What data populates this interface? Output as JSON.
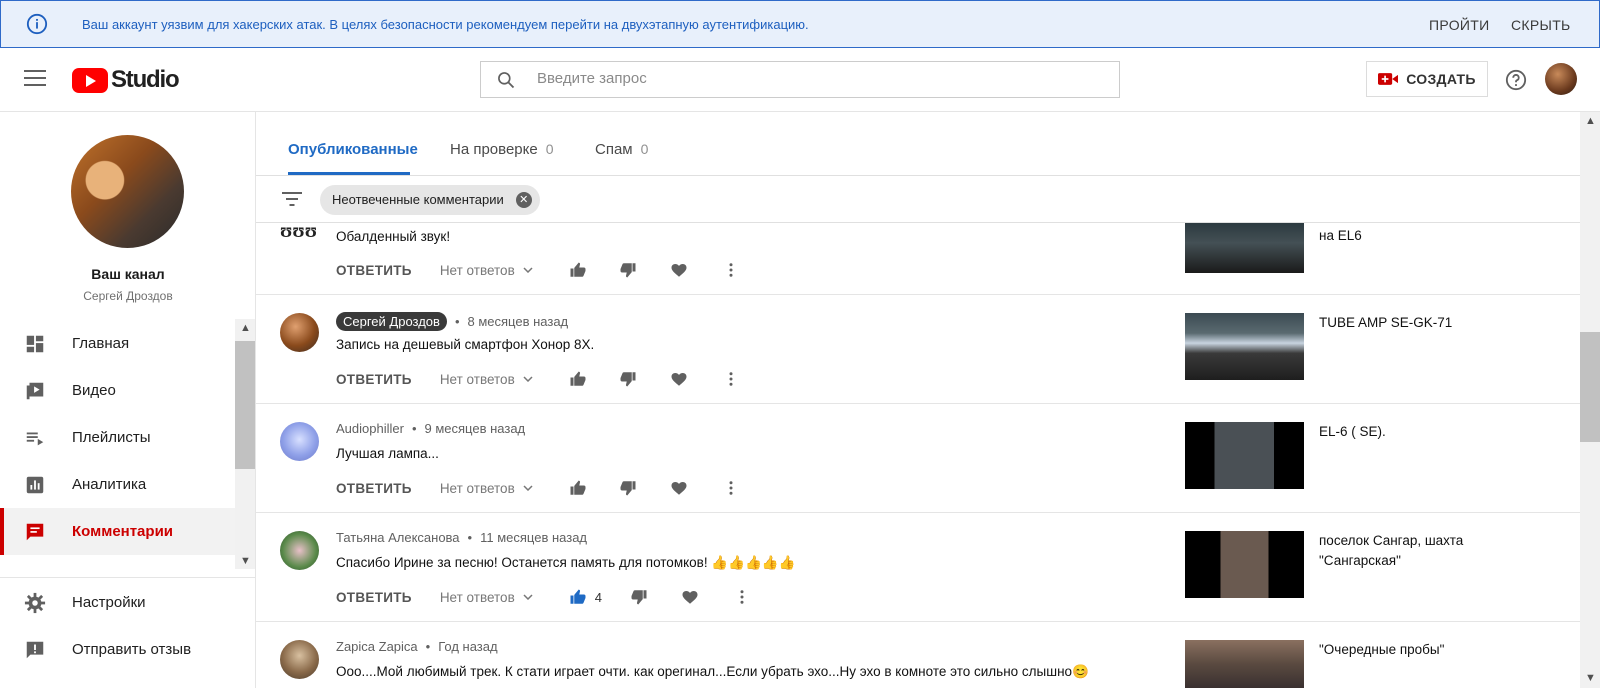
{
  "banner": {
    "message": "Ваш аккаунт уязвим для хакерских атак. В целях безопасности рекомендуем перейти на двухэтапную аутентификацию.",
    "login_label": "ПРОЙТИ",
    "hide_label": "СКРЫТЬ"
  },
  "header": {
    "logo_text": "Studio",
    "search_placeholder": "Введите запрос",
    "create_label": "СОЗДАТЬ"
  },
  "sidebar": {
    "channel_title": "Ваш канал",
    "channel_owner": "Сергей Дроздов",
    "items": [
      {
        "label": "Главная",
        "icon": "dashboard-icon"
      },
      {
        "label": "Видео",
        "icon": "video-icon"
      },
      {
        "label": "Плейлисты",
        "icon": "playlist-icon"
      },
      {
        "label": "Аналитика",
        "icon": "analytics-icon"
      },
      {
        "label": "Комментарии",
        "icon": "comment-icon",
        "active": true
      },
      {
        "label": "Настройки",
        "icon": "gear-icon"
      },
      {
        "label": "Отправить отзыв",
        "icon": "feedback-icon"
      }
    ]
  },
  "tabs": [
    {
      "label": "Опубликованные",
      "count": "",
      "active": true
    },
    {
      "label": "На проверке",
      "count": "0"
    },
    {
      "label": "Спам",
      "count": "0"
    }
  ],
  "filter": {
    "chip_label": "Неотвеченные комментарии"
  },
  "actions": {
    "reply_label": "ОТВЕТИТЬ",
    "no_replies_label": "Нет ответов"
  },
  "comments": [
    {
      "author": "",
      "time": "",
      "text": "Обалденный звук!",
      "video_title": "на EL6",
      "likes": ""
    },
    {
      "author": "Сергей Дроздов",
      "time": "8 месяцев назад",
      "text": "Запись на дешевый смартфон Хонор 8Х.",
      "video_title": "TUBE AMP SE-GK-71",
      "likes": "",
      "owner": true
    },
    {
      "author": "Audiophiller",
      "time": "9 месяцев назад",
      "text": "Лучшая лампа...",
      "video_title": "EL-6 ( SE).",
      "likes": ""
    },
    {
      "author": "Татьяна Алексанова",
      "time": "11 месяцев назад",
      "text": "Спасибо Ирине за песню!  Останется память для потомков!  👍👍👍👍👍",
      "video_title": "поселок Сангар, шахта \"Сангарская\"",
      "likes": "4"
    },
    {
      "author": "Zapica Zapica",
      "time": "Год назад",
      "text": "Ооо....Мой любимый трек. К стати играет  очти. как орегинал...Если убрать эхо...Ну эхо в комноте  это сильно  слышно😊",
      "video_title": "\"Очередные пробы\"",
      "likes": ""
    }
  ]
}
